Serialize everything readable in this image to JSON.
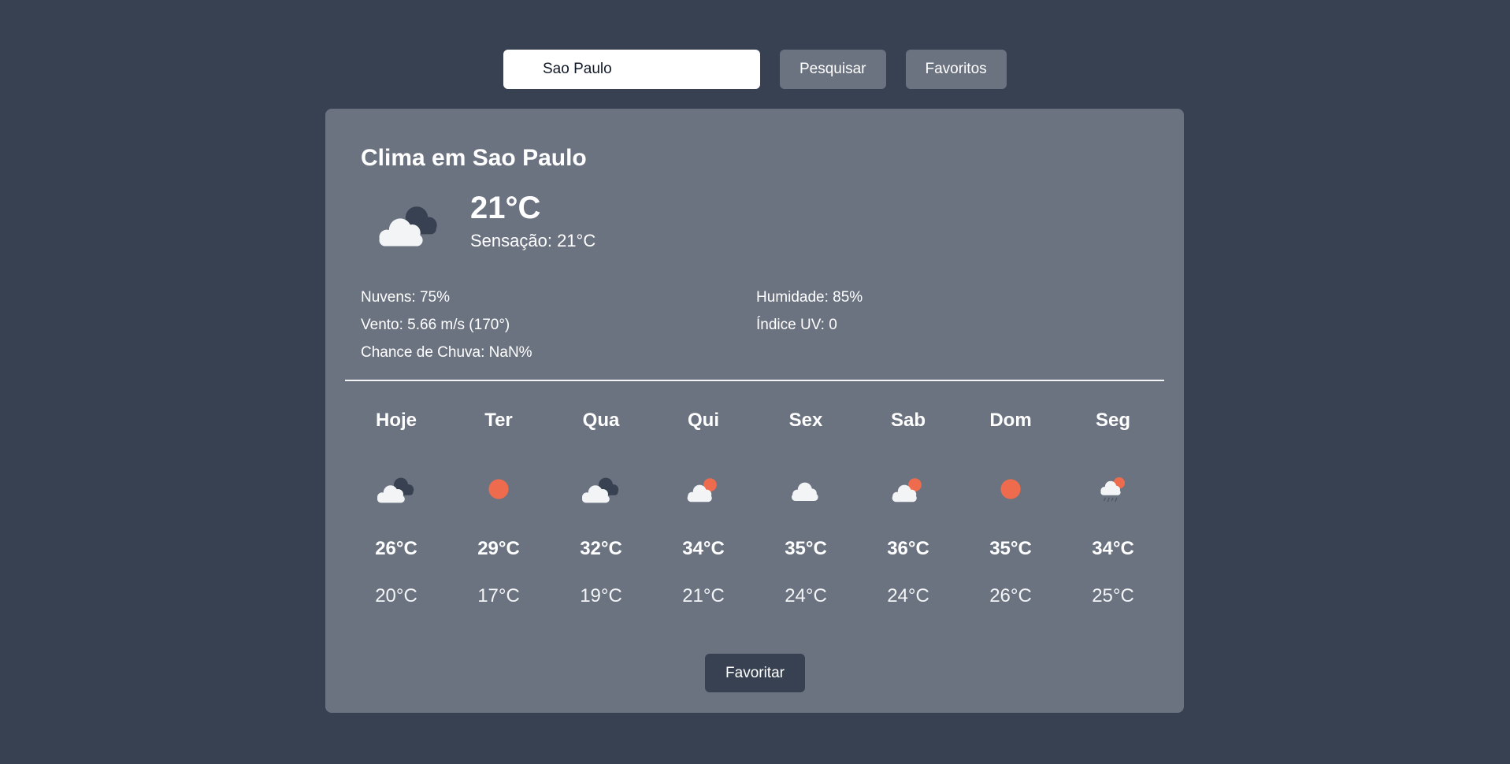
{
  "search": {
    "value": "Sao Paulo",
    "search_button": "Pesquisar",
    "favorites_button": "Favoritos"
  },
  "current": {
    "title": "Clima em Sao Paulo",
    "icon": "cloudy-icon",
    "temp": "21°C",
    "feels_like": "Sensação: 21°C",
    "clouds": "Nuvens: 75%",
    "humidity": "Humidade: 85%",
    "wind": "Vento: 5.66 m/s (170°)",
    "uv": "Índice UV: 0",
    "rain_chance": "Chance de Chuva: NaN%"
  },
  "forecast": [
    {
      "day": "Hoje",
      "icon": "cloudy-icon",
      "max": "26°C",
      "min": "20°C"
    },
    {
      "day": "Ter",
      "icon": "sun-icon",
      "max": "29°C",
      "min": "17°C"
    },
    {
      "day": "Qua",
      "icon": "cloudy-icon",
      "max": "32°C",
      "min": "19°C"
    },
    {
      "day": "Qui",
      "icon": "partly-cloudy-icon",
      "max": "34°C",
      "min": "21°C"
    },
    {
      "day": "Sex",
      "icon": "cloud-icon",
      "max": "35°C",
      "min": "24°C"
    },
    {
      "day": "Sab",
      "icon": "partly-cloudy-icon",
      "max": "36°C",
      "min": "24°C"
    },
    {
      "day": "Dom",
      "icon": "sun-icon",
      "max": "35°C",
      "min": "26°C"
    },
    {
      "day": "Seg",
      "icon": "rain-sun-icon",
      "max": "34°C",
      "min": "25°C"
    }
  ],
  "favorite_button": "Favoritar",
  "colors": {
    "background": "#374151",
    "card": "#6b7280",
    "sun": "#ee6c4d",
    "cloud": "#f3f4f6",
    "dark_cloud": "#4b5563"
  }
}
